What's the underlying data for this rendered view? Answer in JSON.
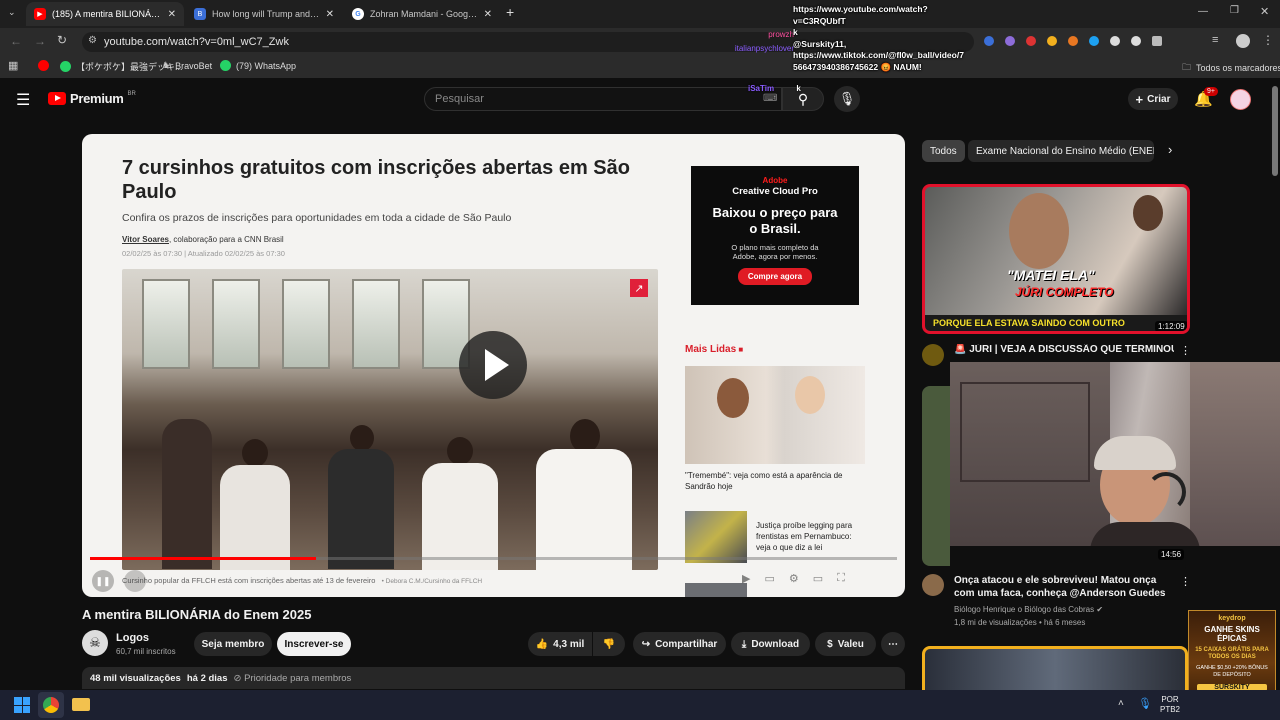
{
  "tabs": [
    {
      "title": "(185) A mentira BILIONÁRIA do",
      "color": "#ff0000"
    },
    {
      "title": "How long will Trump and Zohra",
      "color": "#3b82f6"
    },
    {
      "title": "Zohran Mamdani - Google Sea",
      "color": "#ffffff"
    }
  ],
  "url": "youtube.com/watch?v=0ml_wC7_Zwk",
  "bookmarks": [
    "【ポケポケ】最強デッキ...",
    "BravoBet",
    "(79) WhatsApp"
  ],
  "bookmarks_all": "Todos os marcadores",
  "overlay": {
    "lines": [
      "https://www.youtube.com/watch?",
      "v=C3RQUbfT",
      "k",
      "@Surskity11,",
      "https://www.tiktok.com/@fl0w_ball/video/7",
      "566473940386745622 😡 NAUM!"
    ],
    "user1": "prowzh",
    "user2": "italianpsychlover",
    "user3": "iSaTim",
    "user3_text": "k"
  },
  "yt": {
    "logo": "Premium",
    "region": "BR",
    "search_placeholder": "Pesquisar",
    "create": "Criar",
    "notif_count": "9+"
  },
  "article": {
    "title": "7 cursinhos gratuitos com inscrições abertas em São Paulo",
    "subtitle": "Confira os prazos de inscrições para oportunidades em toda a cidade de São Paulo",
    "author": "Vitor Soares",
    "author_suffix": ", colaboração para a CNN Brasil",
    "date": "02/02/25 às 07:30 | Atualizado 02/02/25 às 07:30",
    "caption": "Cursinho popular da FFLCH está com inscrições abertas até 13 de fevereiro",
    "credit": "• Debora C.M./Cursinho da FFLCH",
    "ad_brand": "Adobe",
    "ad_product": "Creative Cloud Pro",
    "ad_headline": "Baixou o preço para o Brasil.",
    "ad_body": "O plano mais completo da Adobe, agora por menos.",
    "ad_cta": "Compre agora",
    "mais_lidas": "Mais Lidas",
    "news1": "\"Tremembé\": veja como está a aparência de Sandrão hoje",
    "news2": "Justiça proíbe legging para frentistas em Pernambuco: veja o que diz a lei"
  },
  "video": {
    "title": "A mentira BILIONÁRIA do Enem 2025",
    "channel": "Logos",
    "subs": "60,7 mil inscritos",
    "member": "Seja membro",
    "subscribe": "Inscrever-se",
    "likes": "4,3 mil",
    "share": "Compartilhar",
    "download": "Download",
    "thanks": "Valeu",
    "views": "48 mil visualizações",
    "age": "há 2 dias",
    "priority": "Prioridade para membros",
    "progress": 0.28
  },
  "chips": [
    "Todos",
    "Exame Nacional do Ensino Médio (ENEM)"
  ],
  "rec1": {
    "caption1": "\"MATEI ELA\"",
    "caption2": "JÚRI COMPLETO",
    "caption3": "PORQUE ELA ESTAVA SAINDO COM OUTRO",
    "duration": "1:12:09",
    "title": "JÚRI | VEJA A DISCUSSÃO QUE TERMINOU"
  },
  "rec2": {
    "duration": "14:56",
    "title": "Onça atacou e ele sobreviveu! Matou onça com uma faca, conheça @Anderson Guedes",
    "channel": "Biólogo Henrique o Biólogo das Cobras",
    "stats": "1,8 mi de visualizações",
    "age": "há 6 meses"
  },
  "promo": {
    "brand": "keydrop",
    "line1": "GANHE SKINS ÉPICAS",
    "line2": "15 CAIXAS GRÁTIS PARA TODOS OS DIAS",
    "line3": "GANHE $0,50 +20% BÔNUS DE DEPÓSITO",
    "code": "SURSKITY"
  },
  "taskbar": {
    "lang1": "POR",
    "lang2": "PTB2"
  }
}
